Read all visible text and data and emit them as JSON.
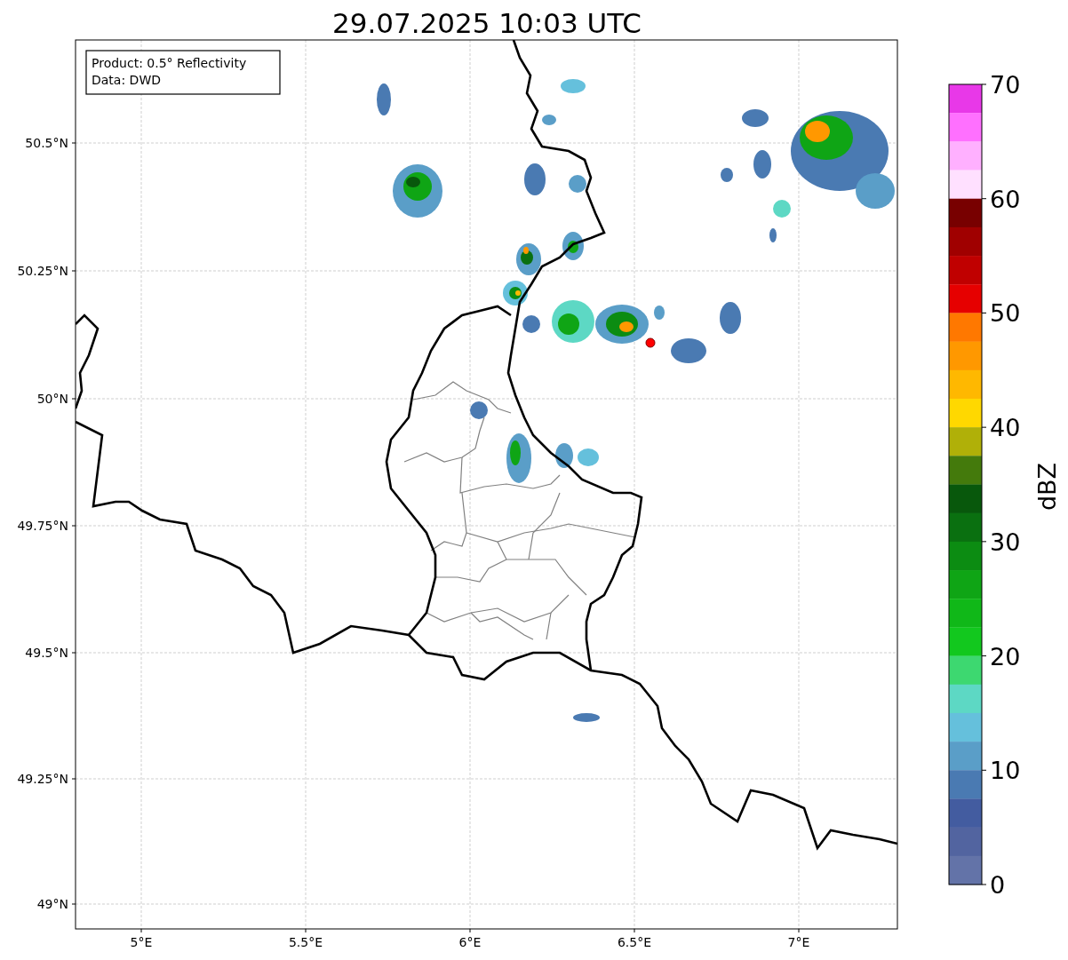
{
  "title": "29.07.2025 10:03 UTC",
  "info_box": [
    "Product: 0.5° Reflectivity",
    "Data: DWD"
  ],
  "map": {
    "x_ticks": [
      "5°E",
      "5.5°E",
      "6°E",
      "6.5°E",
      "7°E"
    ],
    "y_ticks": [
      "50.5°N",
      "50.25°N",
      "50°N",
      "49.75°N",
      "49.5°N",
      "49.25°N",
      "49°N"
    ]
  },
  "colorbar": {
    "label": "dBZ",
    "ticks": [
      "70",
      "60",
      "50",
      "40",
      "30",
      "20",
      "10",
      "0"
    ],
    "bands": [
      {
        "color": "#e838e8"
      },
      {
        "color": "#ff70ff"
      },
      {
        "color": "#ffb0ff"
      },
      {
        "color": "#ffe0ff"
      },
      {
        "color": "#780000"
      },
      {
        "color": "#a00000"
      },
      {
        "color": "#c00000"
      },
      {
        "color": "#e60000"
      },
      {
        "color": "#ff7800"
      },
      {
        "color": "#ff9800"
      },
      {
        "color": "#ffb800"
      },
      {
        "color": "#ffd800"
      },
      {
        "color": "#b0b008"
      },
      {
        "color": "#447a0c"
      },
      {
        "color": "#08580c"
      },
      {
        "color": "#0a7010"
      },
      {
        "color": "#0c8c12"
      },
      {
        "color": "#0fa515"
      },
      {
        "color": "#10b818"
      },
      {
        "color": "#12c81e"
      },
      {
        "color": "#3dd870"
      },
      {
        "color": "#5dd8c4"
      },
      {
        "color": "#65c0dc"
      },
      {
        "color": "#5a9ec8"
      },
      {
        "color": "#4a7ab2"
      },
      {
        "color": "#435ca0"
      },
      {
        "color": "#5264a0"
      },
      {
        "color": "#6373a8"
      }
    ]
  }
}
